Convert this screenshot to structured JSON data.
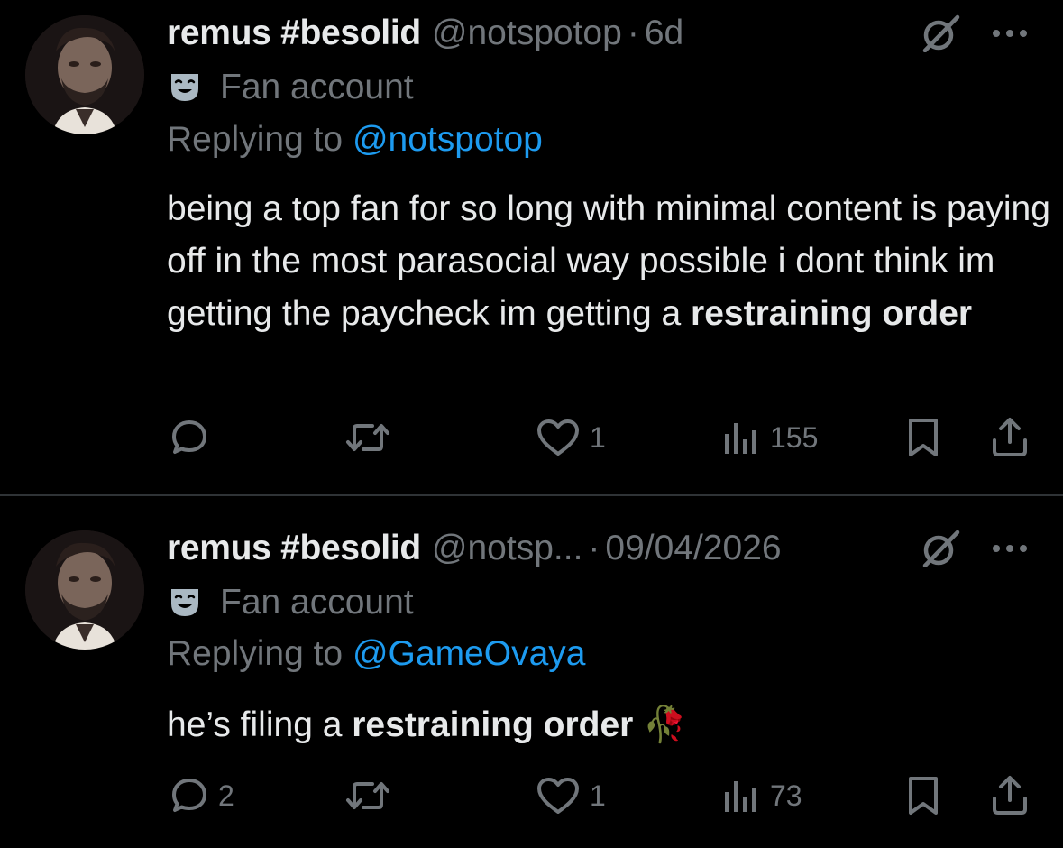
{
  "colors": {
    "background": "#000000",
    "text": "#e7e9ea",
    "muted": "#71767b",
    "link": "#1d9bf0",
    "divider": "#2f3336"
  },
  "tweets": [
    {
      "display_name": "remus #besolid",
      "handle": "@notspotop",
      "dot": "·",
      "time": "6d",
      "fan_label": "Fan account",
      "replying_prefix": "Replying to ",
      "replying_to": "@notspotop",
      "body_plain": "being a top fan for so long with minimal content is paying off in the most parasocial way possible i dont think im getting the paycheck im getting a ",
      "body_bold": "restraining order",
      "body_emoji": "",
      "stats": {
        "replies": "",
        "retweets": "",
        "likes": "1",
        "views": "155"
      }
    },
    {
      "display_name": "remus #besolid",
      "handle": "@notsp...",
      "dot": "·",
      "time": "09/04/2026",
      "fan_label": "Fan account",
      "replying_prefix": "Replying to ",
      "replying_to": "@GameOvaya",
      "body_plain": "he’s filing a ",
      "body_bold": "restraining order",
      "body_emoji": "🥀",
      "stats": {
        "replies": "2",
        "retweets": "",
        "likes": "1",
        "views": "73"
      }
    }
  ]
}
